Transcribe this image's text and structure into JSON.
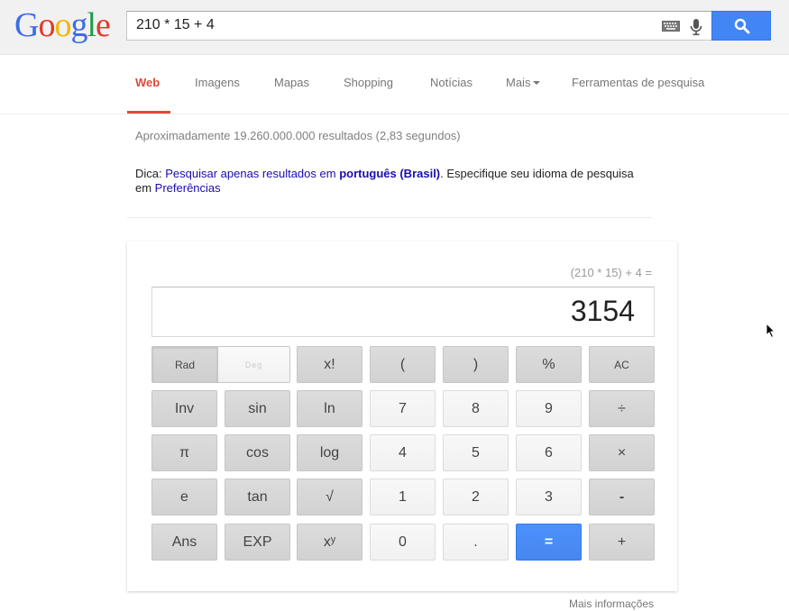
{
  "header": {
    "logo_text": "Google",
    "search_query": "210 * 15 + 4",
    "accent_color": "#4285f4"
  },
  "tabs": [
    {
      "label": "Web",
      "active": true
    },
    {
      "label": "Imagens",
      "active": false
    },
    {
      "label": "Mapas",
      "active": false
    },
    {
      "label": "Shopping",
      "active": false
    },
    {
      "label": "Notícias",
      "active": false
    },
    {
      "label": "Mais",
      "active": false
    },
    {
      "label": "Ferramentas de pesquisa",
      "active": false
    }
  ],
  "results": {
    "stats": "Aproximadamente 19.260.000.000 resultados (2,83 segundos)",
    "tip_prefix": "Dica: ",
    "tip_link1": "Pesquisar apenas resultados em ",
    "tip_bold": "português (Brasil)",
    "tip_mid": ". Especifique seu idioma de pesquisa em ",
    "tip_link2": "Preferências"
  },
  "calculator": {
    "expression": "(210 * 15) + 4 =",
    "result": "3154",
    "rad_label": "Rad",
    "deg_label": "Deg",
    "buttons": {
      "fact": "x!",
      "lparen": "(",
      "rparen": ")",
      "percent": "%",
      "ac": "AC",
      "inv": "Inv",
      "sin": "sin",
      "ln": "ln",
      "n7": "7",
      "n8": "8",
      "n9": "9",
      "div": "÷",
      "pi": "π",
      "cos": "cos",
      "log": "log",
      "n4": "4",
      "n5": "5",
      "n6": "6",
      "mul": "×",
      "e": "e",
      "tan": "tan",
      "sqrt": "√",
      "n1": "1",
      "n2": "2",
      "n3": "3",
      "minus": "-",
      "ans": "Ans",
      "exp": "EXP",
      "pow": "xʸ",
      "n0": "0",
      "dot": ".",
      "eq": "=",
      "plus": "+"
    },
    "more_info": "Mais informações"
  }
}
